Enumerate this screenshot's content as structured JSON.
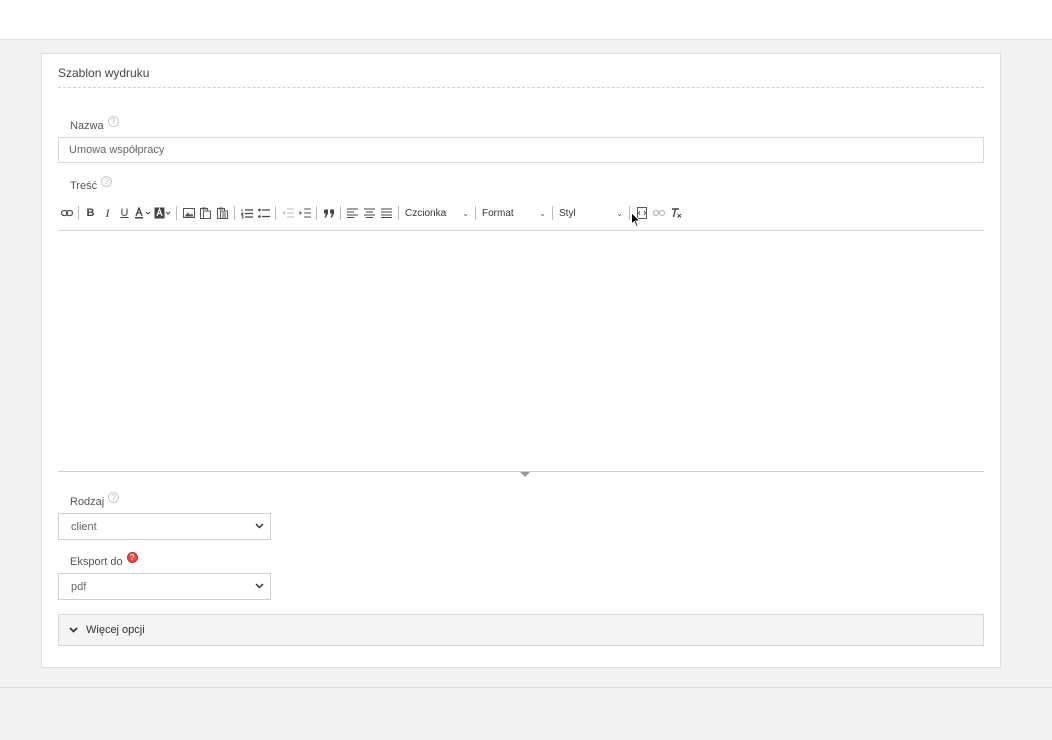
{
  "panel": {
    "title": "Szablon wydruku"
  },
  "fields": {
    "nazwa": {
      "label": "Nazwa",
      "help": "?",
      "value": "Umowa współpracy"
    },
    "tresc": {
      "label": "Treść",
      "help": "?"
    },
    "rodzaj": {
      "label": "Rodzaj",
      "help": "?",
      "selected": "client"
    },
    "eksport": {
      "label": "Eksport do",
      "help": "?",
      "selected": "pdf"
    }
  },
  "toolbar": {
    "font_combo": "Czcionka",
    "format_combo": "Format",
    "style_combo": "Styl",
    "bold": "B",
    "italic": "I",
    "underline": "U",
    "quote": "99",
    "combo_arrow": "⌄"
  },
  "more_options": {
    "label": "Więcej opcji",
    "chevron": "❯"
  },
  "icons": {
    "select_chevron": "⌄"
  }
}
